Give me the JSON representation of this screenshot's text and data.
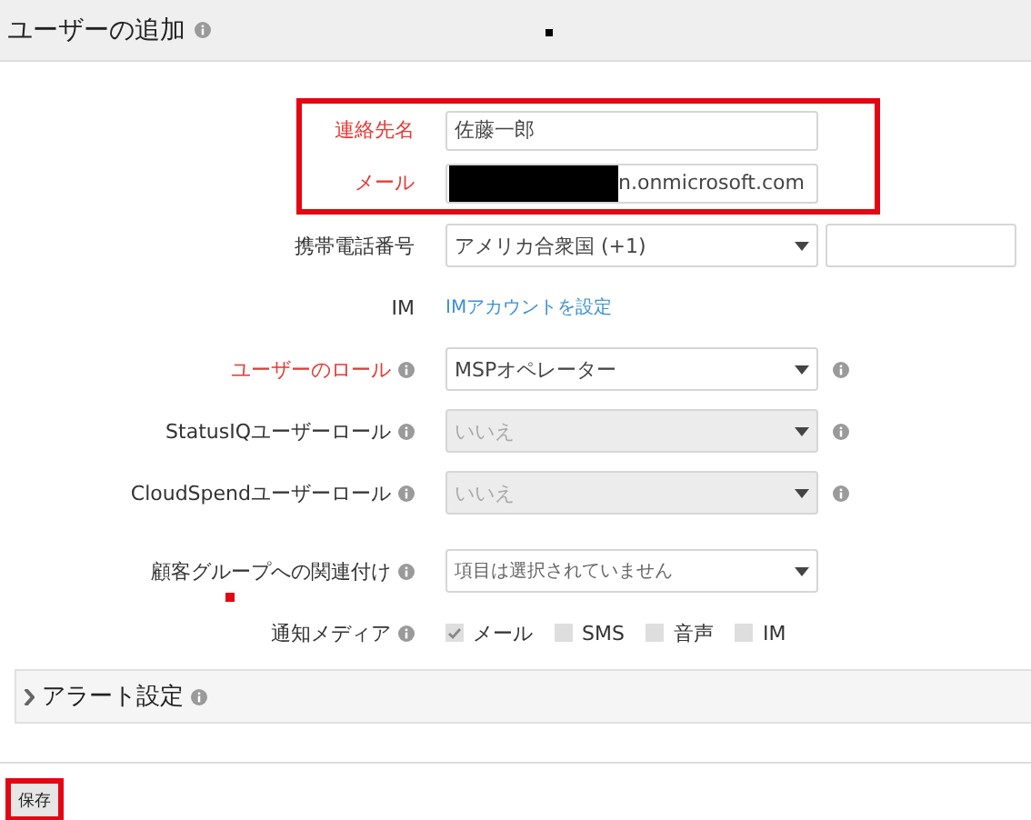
{
  "header": {
    "title": "ユーザーの追加",
    "info": true,
    "dot": true
  },
  "fields": [
    {
      "kind": "text",
      "label": "連絡先名",
      "required": true,
      "highlighted": true,
      "value": "佐藤一郎"
    },
    {
      "kind": "text",
      "label": "メール",
      "required": true,
      "highlighted": true,
      "redacted": true,
      "value": "n.onmicrosoft.com"
    },
    {
      "kind": "phone",
      "label": "携帯電話番号",
      "value": "アメリカ合衆国 (+1)"
    },
    {
      "kind": "link",
      "label": "IM",
      "link": "IMアカウントを設定"
    },
    {
      "kind": "select",
      "label": "ユーザーのロール",
      "required": true,
      "info": true,
      "help": true,
      "disabled": false,
      "value": "MSPオペレーター"
    },
    {
      "kind": "select",
      "label": "StatusIQユーザーロール",
      "info": true,
      "help": true,
      "disabled": true,
      "value": "いいえ"
    },
    {
      "kind": "select",
      "label": "CloudSpendユーザーロール",
      "info": true,
      "help": true,
      "disabled": true,
      "value": "いいえ"
    },
    {
      "kind": "select",
      "label": "顧客グループへの関連付け",
      "info": true,
      "marked": true,
      "disabled": false,
      "placeholder": "項目は選択されていません"
    },
    {
      "kind": "checks",
      "label": "通知メディア",
      "info": true,
      "options": [
        {
          "label": "メール",
          "checked": true
        },
        {
          "label": "SMS",
          "checked": false
        },
        {
          "label": "音声",
          "checked": false
        },
        {
          "label": "IM",
          "checked": false
        }
      ]
    }
  ],
  "section": {
    "title": "アラート設定",
    "expanded": false,
    "info": true
  },
  "save": {
    "label": "保存",
    "highlighted": true
  }
}
